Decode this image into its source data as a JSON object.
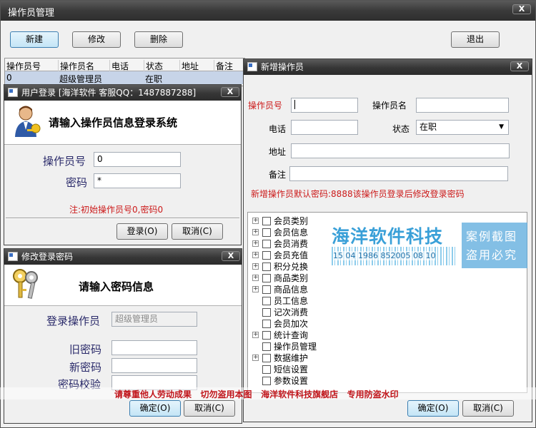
{
  "main": {
    "title": "操作员管理",
    "close": "X",
    "toolbar": {
      "new": "新建",
      "edit": "修改",
      "delete": "删除",
      "exit": "退出"
    },
    "columns": [
      "操作员号",
      "操作员名",
      "电话",
      "状态",
      "地址",
      "备注"
    ],
    "row": {
      "id": "0",
      "name": "超级管理员",
      "phone": "",
      "status": "在职",
      "address": "",
      "note": ""
    }
  },
  "login": {
    "title": "用户登录 [海洋软件 客服QQ：1487887288]",
    "close": "X",
    "heading": "请输入操作员信息登录系统",
    "op_label": "操作员号",
    "op_value": "0",
    "pwd_label": "密码",
    "pwd_value": "*",
    "note": "注:初始操作员号0,密码0",
    "ok": "登录(O)",
    "cancel": "取消(C)"
  },
  "change_pwd": {
    "title": "修改登录密码",
    "close": "X",
    "heading": "请输入密码信息",
    "op_label": "登录操作员",
    "op_value": "超级管理员",
    "old_label": "旧密码",
    "new_label": "新密码",
    "check_label": "密码校验",
    "ok": "确定(O)",
    "cancel": "取消(C)"
  },
  "new_op": {
    "title": "新增操作员",
    "close": "X",
    "op_id_label": "操作员号",
    "op_name_label": "操作员名",
    "phone_label": "电话",
    "status_label": "状态",
    "status_value": "在职",
    "address_label": "地址",
    "note_label": "备注",
    "hint": "新增操作员默认密码:8888该操作员登录后修改登录密码",
    "tree": [
      {
        "label": "会员类别",
        "expandable": true
      },
      {
        "label": "会员信息",
        "expandable": true
      },
      {
        "label": "会员消费",
        "expandable": true
      },
      {
        "label": "会员充值",
        "expandable": true
      },
      {
        "label": "积分兑换",
        "expandable": true
      },
      {
        "label": "商品类别",
        "expandable": true
      },
      {
        "label": "商品信息",
        "expandable": true
      },
      {
        "label": "员工信息",
        "expandable": false
      },
      {
        "label": "记次消费",
        "expandable": false
      },
      {
        "label": "会员加次",
        "expandable": false
      },
      {
        "label": "统计查询",
        "expandable": true
      },
      {
        "label": "操作员管理",
        "expandable": false
      },
      {
        "label": "数据维护",
        "expandable": true
      },
      {
        "label": "短信设置",
        "expandable": false
      },
      {
        "label": "参数设置",
        "expandable": false
      }
    ],
    "ok": "确定(O)",
    "cancel": "取消(C)"
  },
  "watermark": {
    "brand": "海洋软件科技",
    "digits": "15 04 1986 852005 08 10",
    "stamp_line1": "案例截图",
    "stamp_line2": "盗用必究",
    "footer": "请尊重他人劳动成果   切勿盗用本图   海洋软件科技旗舰店   专用防盗水印"
  },
  "colors": {
    "accent_red": "#cc1a1a",
    "label_blue": "#2a2a6a",
    "titlebar": "#3a3a3a"
  }
}
